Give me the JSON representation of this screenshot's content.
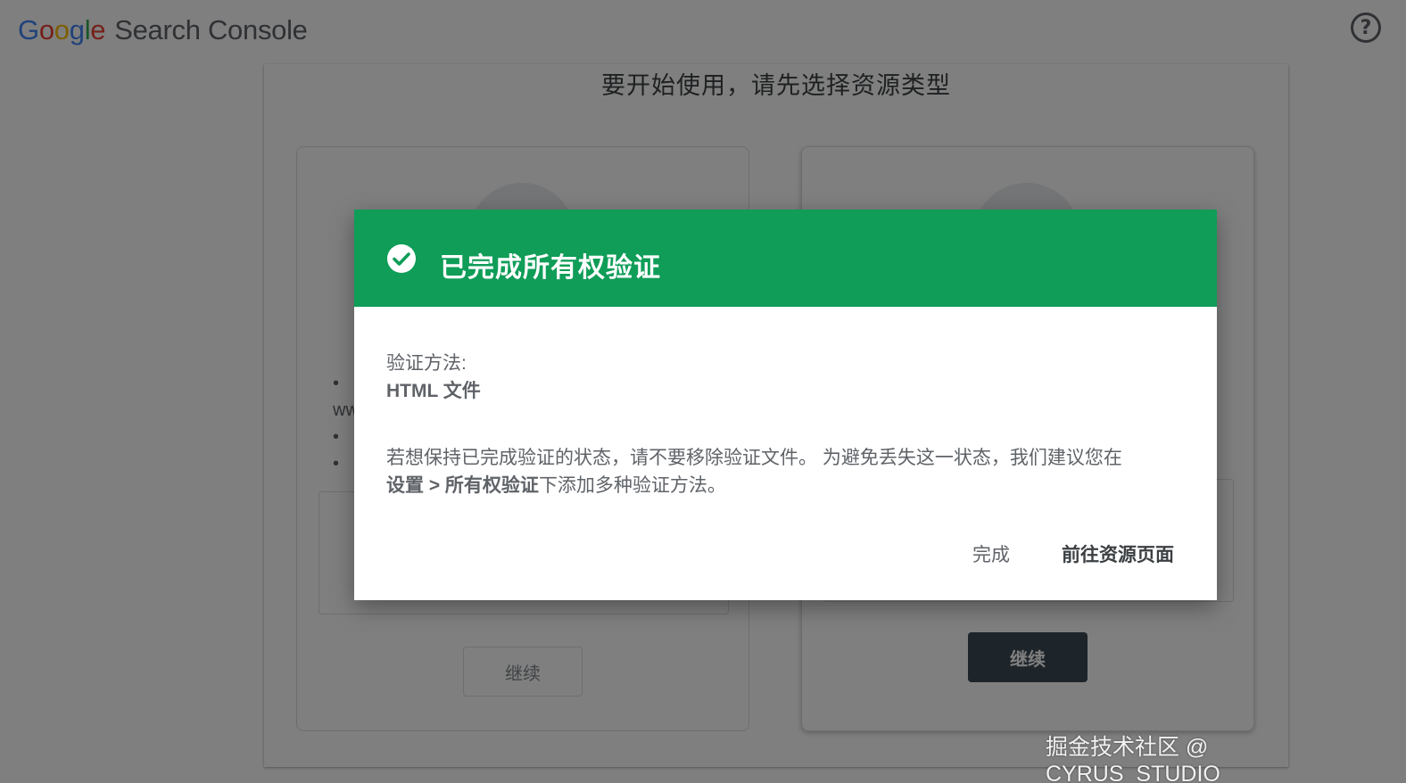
{
  "header": {
    "logo_letters": [
      "G",
      "o",
      "o",
      "g",
      "l",
      "e"
    ],
    "logo_colors": [
      "#4285f4",
      "#ea4335",
      "#fbbc05",
      "#4285f4",
      "#34a853",
      "#ea4335"
    ],
    "product_name": "Search Console",
    "help_icon": "help-circle-icon",
    "help_glyph": "?"
  },
  "page": {
    "heading": "要开始使用，请先选择资源类型",
    "left_option": {
      "bullets": [
        "•",
        "•",
        "•"
      ],
      "partial_text": "ww",
      "continue_label": "继续"
    },
    "right_option": {
      "continue_label": "继续"
    }
  },
  "dialog": {
    "header_color": "#0f9d58",
    "icon": "check-circle-icon",
    "title": "已完成所有权验证",
    "method_label": "验证方法:",
    "method_value": "HTML 文件",
    "message_part1": "若想保持已完成验证的状态，请不要移除验证文件。 为避免丢失这一状态，我们建议您在",
    "message_bold": "设置 > 所有权验证",
    "message_part2": "下添加多种验证方法。",
    "done_label": "完成",
    "goto_label": "前往资源页面"
  },
  "watermark": "掘金技术社区 @ CYRUS_STUDIO"
}
